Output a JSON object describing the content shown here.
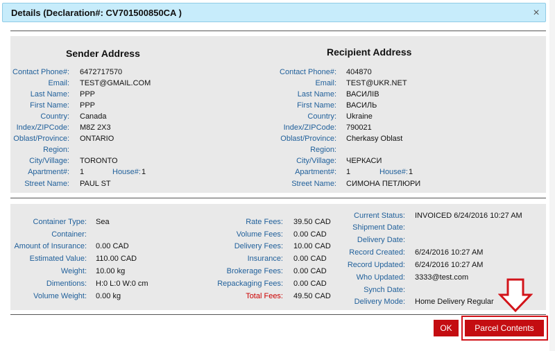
{
  "dialog": {
    "title": "Details (Declaration#: CV701500850CA )",
    "close_glyph": "×"
  },
  "sender": {
    "heading": "Sender Address",
    "rows": [
      {
        "label": "Contact Phone#:",
        "value": "6472717570"
      },
      {
        "label": "Email:",
        "value": "TEST@GMAIL.COM"
      },
      {
        "label": "Last Name:",
        "value": "PPP"
      },
      {
        "label": "First Name:",
        "value": "PPP"
      },
      {
        "label": "Country:",
        "value": "Canada"
      },
      {
        "label": "Index/ZIPCode:",
        "value": "M8Z 2X3"
      },
      {
        "label": "Oblast/Province:",
        "value": "ONTARIO"
      },
      {
        "label": "Region:",
        "value": ""
      },
      {
        "label": "City/Village:",
        "value": "TORONTO"
      },
      {
        "label": "Apartment#:",
        "value": "1",
        "extra_label": "House#:",
        "extra_value": "1"
      },
      {
        "label": "Street Name:",
        "value": "PAUL ST"
      }
    ]
  },
  "recipient": {
    "heading": "Recipient Address",
    "rows": [
      {
        "label": "Contact Phone#:",
        "value": "404870"
      },
      {
        "label": "Email:",
        "value": "TEST@UKR.NET"
      },
      {
        "label": "Last Name:",
        "value": "ВАСИЛІВ"
      },
      {
        "label": "First Name:",
        "value": "ВАСИЛЬ"
      },
      {
        "label": "Country:",
        "value": "Ukraine"
      },
      {
        "label": "Index/ZIPCode:",
        "value": "790021"
      },
      {
        "label": "Oblast/Province:",
        "value": "Cherkasy Oblast"
      },
      {
        "label": "Region:",
        "value": ""
      },
      {
        "label": "City/Village:",
        "value": "ЧЕРКАСИ"
      },
      {
        "label": "Apartment#:",
        "value": "1",
        "extra_label": "House#:",
        "extra_value": "1"
      },
      {
        "label": "Street Name:",
        "value": "СИМОНА ПЕТЛЮРИ"
      }
    ]
  },
  "parcel": {
    "rows": [
      {
        "label": "Container Type:",
        "value": "Sea"
      },
      {
        "label": "Container:",
        "value": ""
      },
      {
        "label": "Amount of Insurance:",
        "value": "0.00 CAD"
      },
      {
        "label": "Estimated Value:",
        "value": "110.00 CAD"
      },
      {
        "label": "Weight:",
        "value": "10.00 kg"
      },
      {
        "label": "Dimentions:",
        "value": "H:0 L:0 W:0 cm"
      },
      {
        "label": "Volume Weight:",
        "value": "0.00 kg"
      }
    ]
  },
  "fees": {
    "rows": [
      {
        "label": "Rate Fees:",
        "value": "39.50 CAD"
      },
      {
        "label": "Volume Fees:",
        "value": "0.00 CAD"
      },
      {
        "label": "Delivery Fees:",
        "value": "10.00 CAD"
      },
      {
        "label": "Insurance:",
        "value": "0.00 CAD"
      },
      {
        "label": "Brokerage Fees:",
        "value": "0.00 CAD"
      },
      {
        "label": "Repackaging Fees:",
        "value": "0.00 CAD"
      },
      {
        "label": "Total Fees:",
        "value": "49.50 CAD",
        "highlight": true
      }
    ]
  },
  "status": {
    "rows": [
      {
        "label": "Current Status:",
        "value": "INVOICED 6/24/2016 10:27 AM"
      },
      {
        "label": "Shipment Date:",
        "value": ""
      },
      {
        "label": "Delivery Date:",
        "value": ""
      },
      {
        "label": "Record Created:",
        "value": "6/24/2016 10:27 AM"
      },
      {
        "label": "Record Updated:",
        "value": "6/24/2016 10:27 AM"
      },
      {
        "label": "Who Updated:",
        "value": "3333@test.com"
      },
      {
        "label": "Synch Date:",
        "value": ""
      },
      {
        "label": "Delivery Mode:",
        "value": "Home Delivery Regular"
      }
    ]
  },
  "buttons": {
    "ok": "OK",
    "parcel_contents": "Parcel Contents"
  },
  "colors": {
    "label_blue": "#1f5f9a",
    "button_red": "#c40d11",
    "title_bg": "#c7ecfb",
    "panel_bg": "#e9e9e9"
  }
}
